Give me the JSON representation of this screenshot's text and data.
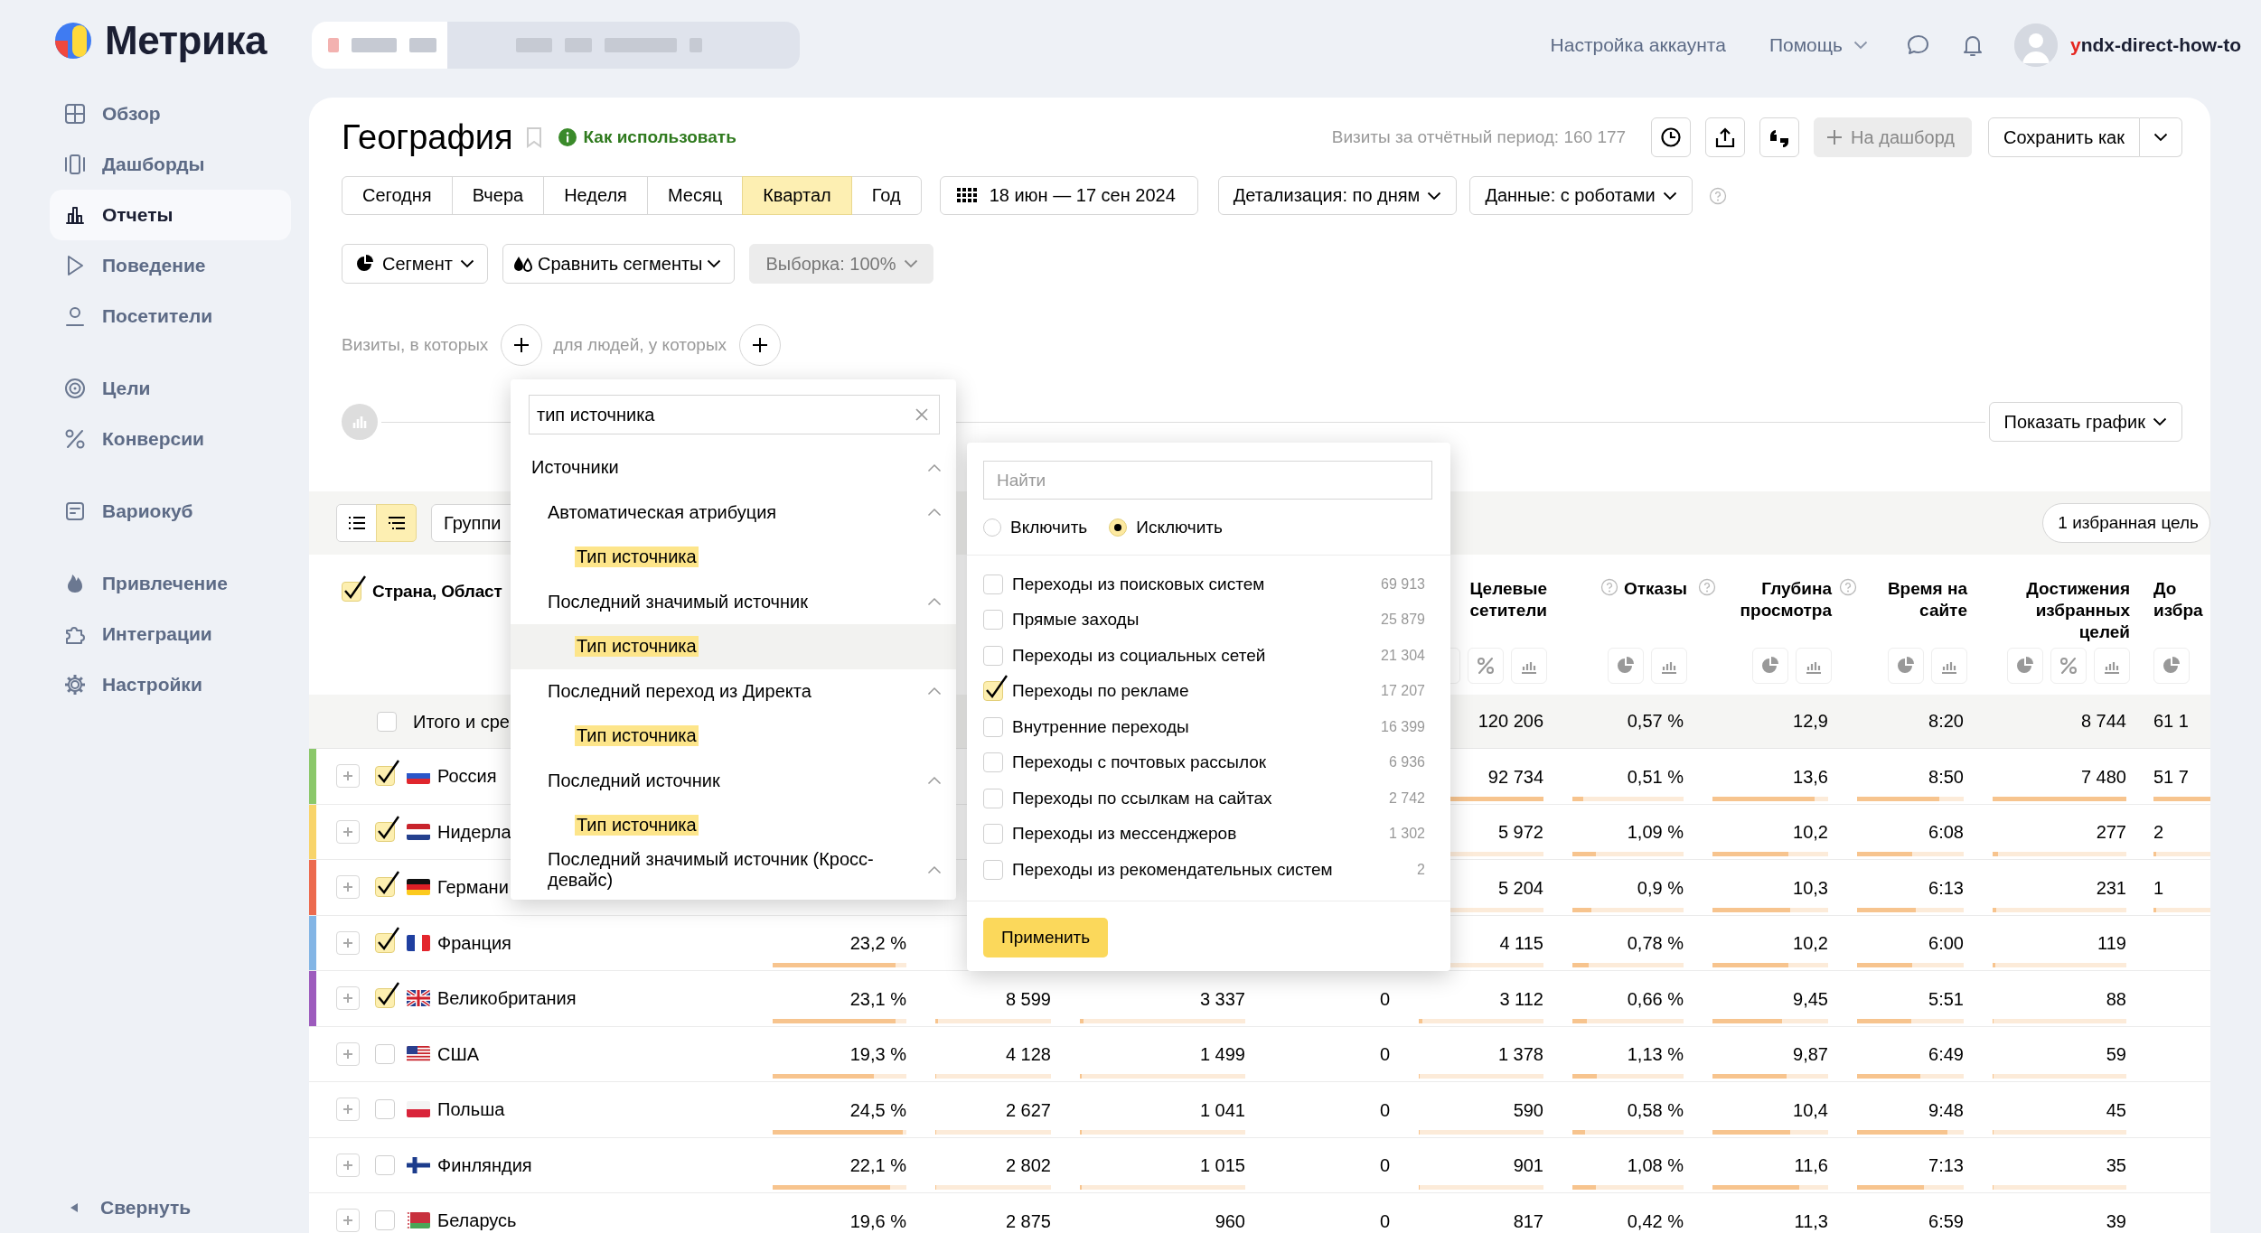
{
  "logo": {
    "text": "Метрика"
  },
  "sidebar": {
    "sections": [
      {
        "items": [
          {
            "label": "Обзор",
            "selected": false
          },
          {
            "label": "Дашборды",
            "selected": false
          },
          {
            "label": "Отчеты",
            "selected": true
          },
          {
            "label": "Поведение",
            "selected": false
          },
          {
            "label": "Посетители",
            "selected": false
          }
        ]
      },
      {
        "items": [
          {
            "label": "Цели",
            "selected": false
          },
          {
            "label": "Конверсии",
            "selected": false
          }
        ]
      },
      {
        "items": [
          {
            "label": "Вариокуб",
            "selected": false
          }
        ]
      },
      {
        "items": [
          {
            "label": "Привлечение",
            "selected": false
          },
          {
            "label": "Интеграции",
            "selected": false
          },
          {
            "label": "Настройки",
            "selected": false
          }
        ]
      }
    ],
    "collapse": "Свернуть"
  },
  "topbar": {
    "account_settings": "Настройка аккаунта",
    "help": "Помощь",
    "username": "yndx-direct-how-to"
  },
  "report": {
    "title": "География",
    "howto": "Как использовать",
    "visits_total": "Визиты за отчётный период: 160 177",
    "add_dashboard": "На дашборд",
    "save_as": "Сохранить как",
    "periods": [
      {
        "label": "Сегодня",
        "selected": false
      },
      {
        "label": "Вчера",
        "selected": false
      },
      {
        "label": "Неделя",
        "selected": false
      },
      {
        "label": "Месяц",
        "selected": false
      },
      {
        "label": "Квартал",
        "selected": true
      },
      {
        "label": "Год",
        "selected": false
      }
    ],
    "date_range": "18 июн — 17 сен 2024",
    "detail": "Детализация: по дням",
    "data_mode": "Данные: с роботами",
    "segment": "Сегмент",
    "compare": "Сравнить сегменты",
    "sample": "Выборка: 100%",
    "filter_visits": "Визиты, в которых",
    "filter_people": "для людей, у которых",
    "show_chart": "Показать график"
  },
  "table": {
    "view_modes": [
      {
        "selected": false
      },
      {
        "selected": true
      }
    ],
    "group_button": "Группи",
    "favorite_goals": "1 избранная цель",
    "name_header": "Страна, Област",
    "name_header_checked": true,
    "columns": [
      null,
      null,
      null,
      null,
      {
        "header": "Целевые сетители",
        "help": false,
        "percent": true
      },
      {
        "header": "Отказы",
        "help": true,
        "percent": false
      },
      {
        "header": "Глубина просмотра",
        "help": true,
        "percent": false
      },
      {
        "header": "Время на сайте",
        "help": true,
        "percent": false
      },
      {
        "header": "Достижения избранных целей",
        "help": false,
        "percent": true
      },
      {
        "header": "До избра",
        "help": false,
        "percent": false
      }
    ],
    "total": {
      "label": "Итого и сре",
      "checked": false,
      "cells": [
        null,
        null,
        null,
        null,
        {
          "value": "120 206"
        },
        {
          "value": "0,57 %"
        },
        {
          "value": "12,9"
        },
        {
          "value": "8:20"
        },
        {
          "value": "8 744"
        },
        {
          "value": "61 1"
        }
      ]
    },
    "rows": [
      {
        "name": "Россия",
        "kind": "ru",
        "checked": true,
        "color": "#8bc86a",
        "cells": [
          null,
          null,
          null,
          null,
          {
            "value": "92 734",
            "level": 1
          },
          {
            "value": "0,51 %",
            "level": 0.1
          },
          {
            "value": "13,6",
            "level": 0.88
          },
          {
            "value": "8:50",
            "level": 0.77
          },
          {
            "value": "7 480",
            "level": 1
          },
          {
            "value": "51 7",
            "level": 1
          }
        ]
      },
      {
        "name": "Нидерла",
        "kind": "nl",
        "checked": true,
        "color": "#f8d46a",
        "cells": [
          null,
          null,
          null,
          null,
          {
            "value": "5 972",
            "level": 0.06
          },
          {
            "value": "1,09 %",
            "level": 0.21
          },
          {
            "value": "10,2",
            "level": 0.66
          },
          {
            "value": "6:08",
            "level": 0.52
          },
          {
            "value": "277",
            "level": 0.04
          },
          {
            "value": "2",
            "level": 0.05
          }
        ]
      },
      {
        "name": "Германи",
        "kind": "de",
        "checked": true,
        "color": "#ec6a4e",
        "cells": [
          null,
          null,
          null,
          null,
          {
            "value": "5 204",
            "level": 0.06
          },
          {
            "value": "0,9 %",
            "level": 0.17
          },
          {
            "value": "10,3",
            "level": 0.67
          },
          {
            "value": "6:13",
            "level": 0.55
          },
          {
            "value": "231",
            "level": 0.03
          },
          {
            "value": "1",
            "level": 0.04
          }
        ]
      },
      {
        "name": "Франция",
        "kind": "fr",
        "checked": true,
        "color": "#83b5e5",
        "cells": [
          {
            "value": "23,2 %",
            "level": 0.92
          },
          null,
          null,
          null,
          {
            "value": "4 115",
            "level": 0.04
          },
          {
            "value": "0,78 %",
            "level": 0.15
          },
          {
            "value": "10,2",
            "level": 0.66
          },
          {
            "value": "6:00",
            "level": 0.52
          },
          {
            "value": "119",
            "level": 0.02
          },
          null
        ]
      },
      {
        "name": "Великобритания",
        "kind": "gb",
        "checked": true,
        "color": "#9d5bbd",
        "cells": [
          {
            "value": "23,1 %",
            "level": 0.92
          },
          {
            "value": "8 599",
            "level": 0.02
          },
          {
            "value": "3 337",
            "level": 0.02
          },
          {
            "value": "0"
          },
          {
            "value": "3 112",
            "level": 0.03
          },
          {
            "value": "0,66 %",
            "level": 0.13
          },
          {
            "value": "9,45",
            "level": 0.6
          },
          {
            "value": "5:51",
            "level": 0.51
          },
          {
            "value": "88",
            "level": 0.01
          },
          null
        ]
      },
      {
        "name": "США",
        "kind": "us",
        "checked": false,
        "cells": [
          {
            "value": "19,3 %",
            "level": 0.76
          },
          {
            "value": "4 128",
            "level": 0.01
          },
          {
            "value": "1 499",
            "level": 0.01
          },
          {
            "value": "0"
          },
          {
            "value": "1 378",
            "level": 0.01
          },
          {
            "value": "1,13 %",
            "level": 0.22
          },
          {
            "value": "9,87",
            "level": 0.64
          },
          {
            "value": "6:49",
            "level": 0.59
          },
          {
            "value": "59",
            "level": 0.01
          },
          null
        ]
      },
      {
        "name": "Польша",
        "kind": "pl",
        "checked": false,
        "cells": [
          {
            "value": "24,5 %",
            "level": 0.97
          },
          {
            "value": "2 627",
            "level": 0.01
          },
          {
            "value": "1 041",
            "level": 0.01
          },
          {
            "value": "0"
          },
          {
            "value": "590",
            "level": 0.01
          },
          {
            "value": "0,58 %",
            "level": 0.11
          },
          {
            "value": "10,4",
            "level": 0.67
          },
          {
            "value": "9:48",
            "level": 0.85
          },
          {
            "value": "45",
            "level": 0.01
          },
          null
        ]
      },
      {
        "name": "Финляндия",
        "kind": "fi",
        "checked": false,
        "cells": [
          {
            "value": "22,1 %",
            "level": 0.88
          },
          {
            "value": "2 802",
            "level": 0.01
          },
          {
            "value": "1 015",
            "level": 0.01
          },
          {
            "value": "0"
          },
          {
            "value": "901",
            "level": 0.01
          },
          {
            "value": "1,08 %",
            "level": 0.21
          },
          {
            "value": "11,6",
            "level": 0.75
          },
          {
            "value": "7:13",
            "level": 0.63
          },
          {
            "value": "35",
            "level": 0.01
          },
          null
        ]
      },
      {
        "name": "Беларусь",
        "kind": "by",
        "checked": false,
        "cells": [
          {
            "value": "19,6 %"
          },
          {
            "value": "2 875"
          },
          {
            "value": "960"
          },
          {
            "value": "0"
          },
          {
            "value": "817"
          },
          {
            "value": "0,42 %"
          },
          {
            "value": "11,3"
          },
          {
            "value": "6:59"
          },
          {
            "value": "39"
          },
          null
        ]
      }
    ]
  },
  "dimension_picker": {
    "query": "тип источника",
    "tree": [
      {
        "label": "Источники",
        "expanded": true,
        "children": [
          {
            "label": "Автоматическая атрибуция",
            "expanded": true,
            "children": [
              {
                "label": "Тип источника",
                "selected": false
              }
            ]
          },
          {
            "label": "Последний значимый источник",
            "expanded": true,
            "children": [
              {
                "label": "Тип источника",
                "selected": true
              }
            ]
          },
          {
            "label": "Последний переход из Директа",
            "expanded": true,
            "children": [
              {
                "label": "Тип источника",
                "selected": false
              }
            ]
          },
          {
            "label": "Последний источник",
            "expanded": true,
            "children": [
              {
                "label": "Тип источника",
                "selected": false
              }
            ]
          },
          {
            "label": "Последний значимый источник (Кросс-девайс)",
            "expanded": true
          }
        ]
      }
    ]
  },
  "value_filter": {
    "placeholder": "Найти",
    "modes": [
      {
        "label": "Включить",
        "selected": false
      },
      {
        "label": "Исключить",
        "selected": true
      }
    ],
    "options": [
      {
        "label": "Переходы из поисковых систем",
        "count": "69 913",
        "checked": false
      },
      {
        "label": "Прямые заходы",
        "count": "25 879",
        "checked": false
      },
      {
        "label": "Переходы из социальных сетей",
        "count": "21 304",
        "checked": false
      },
      {
        "label": "Переходы по рекламе",
        "count": "17 207",
        "checked": true
      },
      {
        "label": "Внутренние переходы",
        "count": "16 399",
        "checked": false
      },
      {
        "label": "Переходы с почтовых рассылок",
        "count": "6 936",
        "checked": false
      },
      {
        "label": "Переходы по ссылкам на сайтах",
        "count": "2 742",
        "checked": false
      },
      {
        "label": "Переходы из мессенджеров",
        "count": "1 302",
        "checked": false
      },
      {
        "label": "Переходы из рекомендательных систем",
        "count": "2",
        "checked": false
      }
    ],
    "apply": "Применить"
  }
}
